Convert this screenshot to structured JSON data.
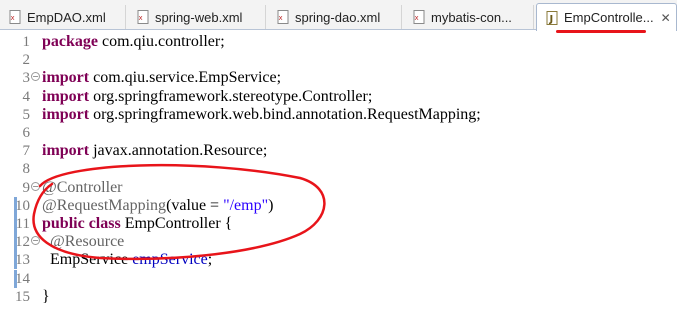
{
  "tabs": [
    {
      "label": "EmpDAO.xml",
      "icon": "xml-file-icon",
      "active": false
    },
    {
      "label": "spring-web.xml",
      "icon": "xml-file-icon",
      "active": false
    },
    {
      "label": "spring-dao.xml",
      "icon": "xml-file-icon",
      "active": false
    },
    {
      "label": "mybatis-con...",
      "icon": "xml-file-icon",
      "active": false
    },
    {
      "label": "EmpControlle...",
      "icon": "java-file-icon",
      "active": true,
      "close": "✕"
    }
  ],
  "lines": [
    {
      "n": "1",
      "parts": [
        [
          "kw",
          "package"
        ],
        [
          "",
          " com.qiu.controller;"
        ]
      ]
    },
    {
      "n": "2",
      "parts": []
    },
    {
      "n": "3",
      "parts": [
        [
          "kw",
          "import"
        ],
        [
          "",
          " com.qiu.service.EmpService;"
        ]
      ]
    },
    {
      "n": "4",
      "parts": [
        [
          "kw",
          "import"
        ],
        [
          "",
          " org.springframework.stereotype.Controller;"
        ]
      ]
    },
    {
      "n": "5",
      "parts": [
        [
          "kw",
          "import"
        ],
        [
          "",
          " org.springframework.web.bind.annotation.RequestMapping;"
        ]
      ]
    },
    {
      "n": "6",
      "parts": []
    },
    {
      "n": "7",
      "parts": [
        [
          "kw",
          "import"
        ],
        [
          "",
          " javax.annotation.Resource;"
        ]
      ]
    },
    {
      "n": "8",
      "parts": []
    },
    {
      "n": "9",
      "parts": [
        [
          "ann",
          "@Controller"
        ]
      ]
    },
    {
      "n": "10",
      "parts": [
        [
          "ann",
          "@RequestMapping"
        ],
        [
          "",
          "(value = "
        ],
        [
          "str",
          "\"/emp\""
        ],
        [
          "",
          ")"
        ]
      ]
    },
    {
      "n": "11",
      "parts": [
        [
          "kw",
          "public class"
        ],
        [
          "",
          " EmpController {"
        ]
      ]
    },
    {
      "n": "12",
      "parts": [
        [
          "",
          "  "
        ],
        [
          "ann",
          "@Resource"
        ]
      ]
    },
    {
      "n": "13",
      "parts": [
        [
          "",
          "  EmpService "
        ],
        [
          "fld",
          "empService"
        ],
        [
          "",
          ";"
        ]
      ]
    },
    {
      "n": "14",
      "parts": []
    },
    {
      "n": "15",
      "parts": [
        [
          "",
          "}"
        ]
      ]
    }
  ],
  "colors": {
    "keyword": "#7f0055",
    "annotation": "#646464",
    "string": "#2a00ff",
    "field": "#0000c0",
    "highlight": "#e8141a"
  }
}
